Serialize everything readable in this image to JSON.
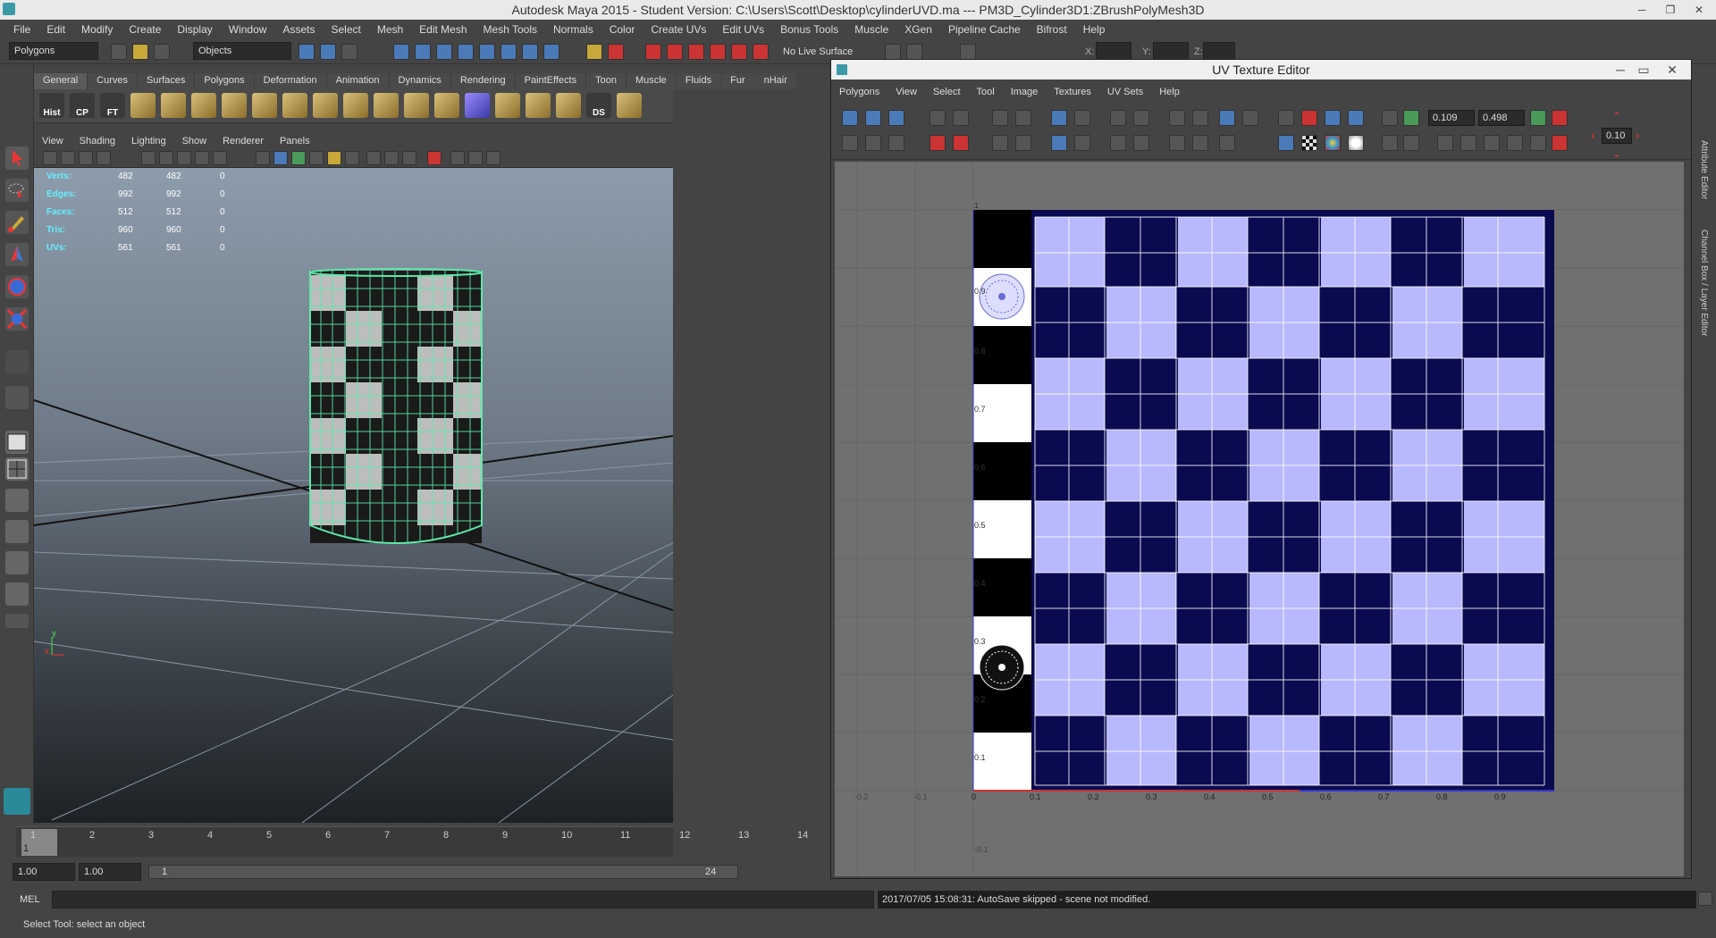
{
  "window": {
    "title": "Autodesk Maya 2015 - Student Version: C:\\Users\\Scott\\Desktop\\cylinderUVD.ma   ---   PM3D_Cylinder3D1:ZBrushPolyMesh3D",
    "min": "─",
    "max": "❐",
    "close": "✕"
  },
  "menubar": [
    "File",
    "Edit",
    "Modify",
    "Create",
    "Display",
    "Window",
    "Assets",
    "Select",
    "Mesh",
    "Edit Mesh",
    "Mesh Tools",
    "Normals",
    "Color",
    "Create UVs",
    "Edit UVs",
    "Bonus Tools",
    "Muscle",
    "XGen",
    "Pipeline Cache",
    "Bifrost",
    "Help"
  ],
  "statusline": {
    "menuset": "Polygons",
    "selection_mode": "Objects",
    "live_surface": "No Live Surface",
    "x_label": "X:",
    "y_label": "Y:",
    "z_label": "Z:"
  },
  "shelf": {
    "tabs": [
      "General",
      "Curves",
      "Surfaces",
      "Polygons",
      "Deformation",
      "Animation",
      "Dynamics",
      "Rendering",
      "PaintEffects",
      "Toon",
      "Muscle",
      "Fluids",
      "Fur",
      "nHair"
    ],
    "active_tab": "General",
    "labels": [
      "Hist",
      "CP",
      "FT",
      "DS"
    ]
  },
  "viewport": {
    "menus": [
      "View",
      "Shading",
      "Lighting",
      "Show",
      "Renderer",
      "Panels"
    ],
    "hud": {
      "rows": [
        {
          "label": "Verts:",
          "a": "482",
          "b": "482",
          "c": "0"
        },
        {
          "label": "Edges:",
          "a": "992",
          "b": "992",
          "c": "0"
        },
        {
          "label": "Faces:",
          "a": "512",
          "b": "512",
          "c": "0"
        },
        {
          "label": "Tris:",
          "a": "960",
          "b": "960",
          "c": "0"
        },
        {
          "label": "UVs:",
          "a": "561",
          "b": "561",
          "c": "0"
        }
      ]
    },
    "axis": {
      "x": "x",
      "y": "y"
    }
  },
  "timeline": {
    "ticks": [
      "1",
      "2",
      "3",
      "4",
      "5",
      "6",
      "7",
      "8",
      "9",
      "10",
      "11",
      "12",
      "13",
      "14"
    ],
    "current": "1"
  },
  "rangebar": {
    "start": "1.00",
    "playback_start": "1.00",
    "range_start": "1",
    "range_end": "24"
  },
  "uv_editor": {
    "title": "UV Texture Editor",
    "min": "─",
    "max": "▭",
    "close": "✕",
    "menus": [
      "Polygons",
      "View",
      "Select",
      "Tool",
      "Image",
      "Textures",
      "UV Sets",
      "Help"
    ],
    "u_value": "0.109",
    "v_value": "0.498",
    "step_value": "0.10",
    "v_labels": [
      "0.9",
      "0.8",
      "0.7",
      "0.6",
      "0.5",
      "0.4",
      "0.3",
      "0.2",
      "0.1",
      "1",
      "-0.1"
    ],
    "u_labels": [
      "-0.2",
      "-0.1",
      "0",
      "0.1",
      "0.2",
      "0.3",
      "0.4",
      "0.5",
      "0.6",
      "0.7",
      "0.8",
      "0.9"
    ]
  },
  "rightbar": {
    "tab1": "Attribute Editor",
    "tab2": "Channel Box / Layer Editor"
  },
  "cmdline": {
    "lang": "MEL",
    "result": "2017/07/05 15:08:31: AutoSave skipped - scene not modified."
  },
  "helpline": "Select Tool: select an object",
  "colors": {
    "wire": "#5ee8a8",
    "checker_dark": "#0a0a50",
    "checker_light": "#b8b8ff",
    "accent_red": "#c33333"
  }
}
